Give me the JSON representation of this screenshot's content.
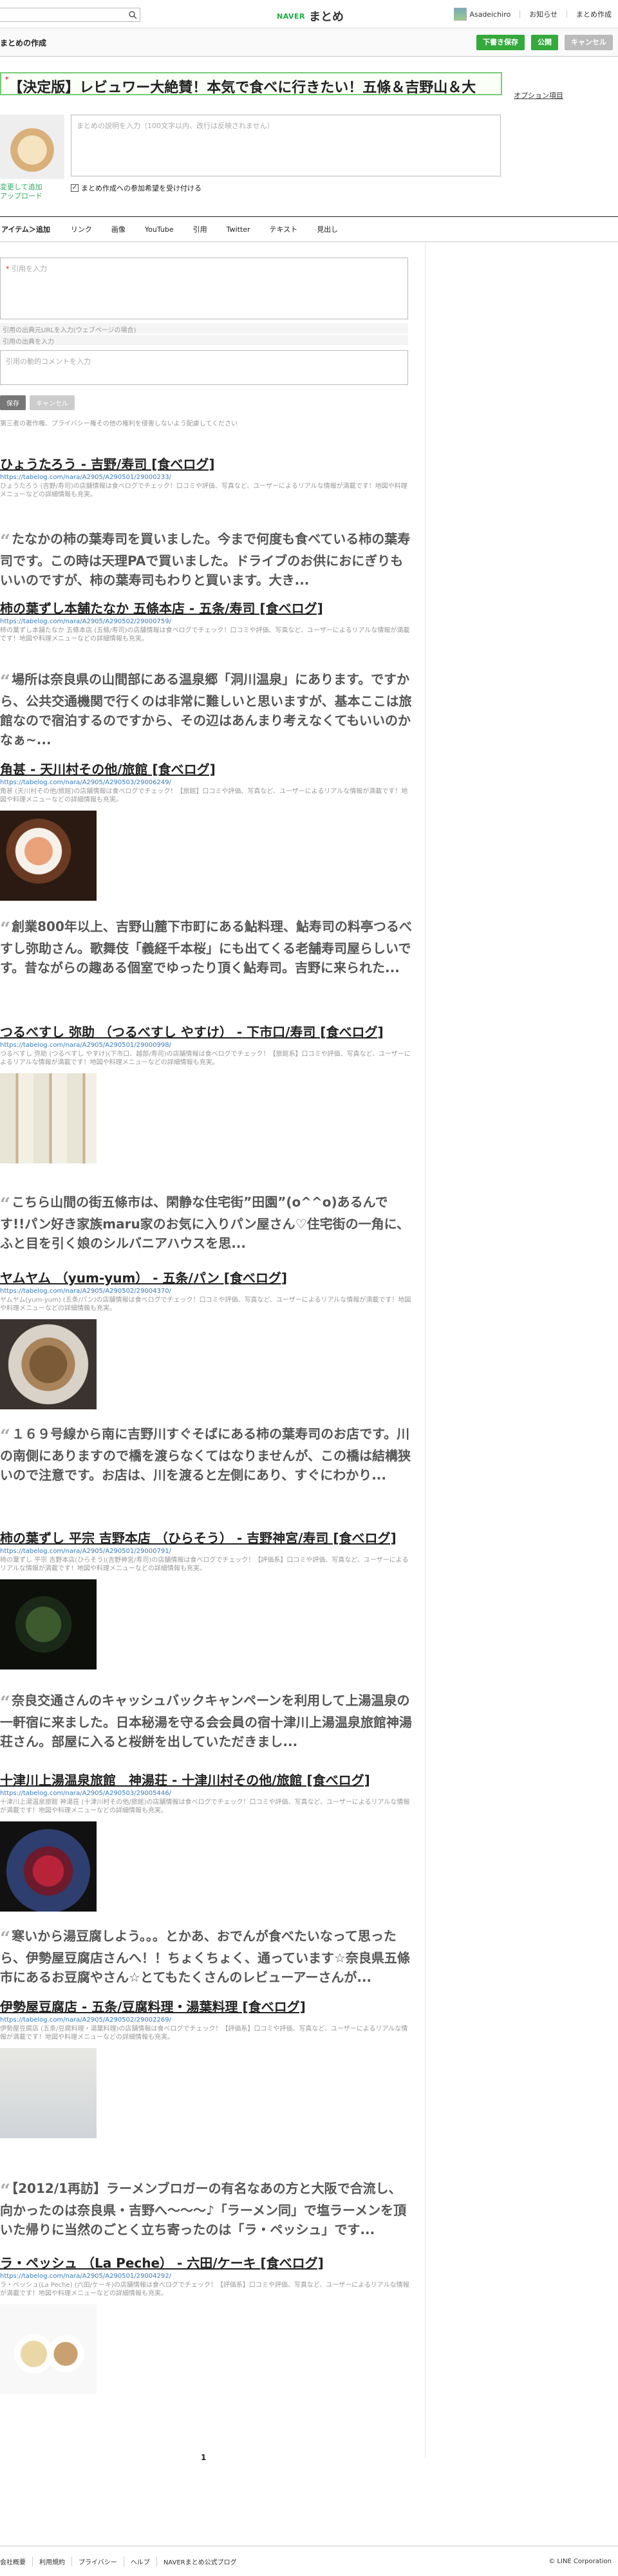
{
  "header": {
    "brand_naver": "NAVER",
    "brand_matome": "まとめ",
    "user_name": "Asadeichiro",
    "nav": [
      "お知らせ",
      "まとめ作成"
    ]
  },
  "subheader": {
    "title": "まとめの作成",
    "buttons": {
      "draft": "下書き保存",
      "publish": "公開",
      "cancel": "キャンセル"
    }
  },
  "editor": {
    "title_value": "【決定版】レビュワー大絶賛！本気で食べに行きたい！五條＆吉野山＆大",
    "options_link": "オプション項目",
    "thumb_change": "変更して追加",
    "thumb_upload": "アップロード",
    "description_placeholder": "まとめの説明を入力（100文字以内、改行は反映されません）",
    "participation_label": "まとめ作成への参加希望を受け付ける"
  },
  "tabs": {
    "lead": "アイテム＞追加",
    "items": [
      "リンク",
      "画像",
      "YouTube",
      "引用",
      "Twitter",
      "テキスト",
      "見出し"
    ]
  },
  "quote_form": {
    "text_placeholder": "引用を入力",
    "url_placeholder": "引用の出典元URLを入力(ウェブページの場合)",
    "source_placeholder": "引用の出典を入力",
    "comment_placeholder": "引用の動的コメントを入力",
    "save": "保存",
    "cancel": "キャンセル",
    "note": "第三者の著作権、プライバシー権その他の権利を侵害しないよう配慮してください"
  },
  "items": [
    {
      "kind": "link",
      "title": "ひょうたろう - 吉野/寿司 [食べログ]",
      "url": "https://tabelog.com/nara/A2905/A290501/29000233/",
      "snippet": "ひょうたろう (吉野/寿司)の店舗情報は食べログでチェック！口コミや評価、写真など、ユーザーによるリアルな情報が満載です！地図や料理メニューなどの詳細情報も充実。"
    },
    {
      "kind": "quote",
      "text": "たなかの柿の葉寿司を買いました。今まで何度も食べている柿の葉寿司です。この時は天理PAで買いました。ドライブのお供におにぎりもいいのですが、柿の葉寿司もわりと買います。大き..."
    },
    {
      "kind": "link",
      "title": "柿の葉ずし本舗たなか 五條本店 - 五条/寿司 [食べログ]",
      "url": "https://tabelog.com/nara/A2905/A290502/29000759/",
      "snippet": "柿の葉ずし本舗たなか 五條本店 (五條/寿司)の店舗情報は食べログでチェック！口コミや評価、写真など、ユーザーによるリアルな情報が満載です！地図や料理メニューなどの詳細情報も充実。"
    },
    {
      "kind": "quote",
      "text": "場所は奈良県の山間部にある温泉郷「洞川温泉」にあります。ですから、公共交通機関で行くのは非常に難しいと思いますが、基本ここは旅館なので宿泊するのですから、その辺はあんまり考えなくてもいいのかなぁ~..."
    },
    {
      "kind": "link",
      "title": "角甚 - 天川村その他/旅館 [食べログ]",
      "url": "https://tabelog.com/nara/A2905/A290503/29006249/",
      "snippet": "角甚 (天川村その他/旅館)の店舗情報は食べログでチェック！【旅館】口コミや評価、写真など、ユーザーによるリアルな情報が満載です！地図や料理メニューなどの詳細情報も充実。",
      "image": "sashimi"
    },
    {
      "kind": "quote",
      "text": "創業800年以上、吉野山麓下市町にある鮎料理、鮎寿司の料亭つるべすし弥助さん。歌舞伎「義経千本桜」にも出てくる老舗寿司屋らしいです。昔ながらの趣ある個室でゆったり頂く鮎寿司。吉野に来られた..."
    },
    {
      "kind": "link",
      "title": "つるべすし 弥助 （つるべすし やすけ） - 下市口/寿司 [食べログ]",
      "url": "https://tabelog.com/nara/A2905/A290501/29000998/",
      "snippet": "つるべすし 弥助 (つるべすし やすけ)(下市口、越部/寿司)の店舗情報は食べログでチェック！【旅館系】口コミや評価、写真など、ユーザーによるリアルな情報が満載です！地図や料理メニューなどの詳細情報も充実。",
      "image": "sushi"
    },
    {
      "kind": "quote",
      "text": "こちら山間の街五條市は、閑静な住宅街”田園”(o^^o)あるんです!!パン好き家族maru家のお気に入りパン屋さん♡住宅街の一角に、ふと目を引く娘のシルバニアハウスを思..."
    },
    {
      "kind": "link",
      "title": "ヤムヤム （yum-yum） - 五条/パン [食べログ]",
      "url": "https://tabelog.com/nara/A2905/A290502/29004370/",
      "snippet": "ヤムヤム(yum-yum) (五条/パン)の店舗情報は食べログでチェック！口コミや評価、写真など、ユーザーによるリアルな情報が満載です！地図や料理メニューなどの詳細情報も充実。",
      "image": "bread"
    },
    {
      "kind": "quote",
      "text": "１６９号線から南に吉野川すぐそばにある柿の葉寿司のお店です。川の南側にありますので橋を渡らなくてはなりませんが、この橋は結構狭いので注意です。お店は、川を渡ると左側にあり、すぐにわかり..."
    },
    {
      "kind": "link",
      "title": "柿の葉ずし 平宗 吉野本店 （ひらそう） - 吉野神宮/寿司 [食べログ]",
      "url": "https://tabelog.com/nara/A2905/A290501/29000791/",
      "snippet": "柿の葉ずし 平宗 吉野本店(ひらそう)(吉野神宮/寿司)の店舗情報は食べログでチェック！【評価系】口コミや評価、写真など、ユーザーによるリアルな情報が満載です！地図や料理メニューなどの詳細情報も充実。",
      "image": "kaki"
    },
    {
      "kind": "quote",
      "text": "奈良交通さんのキャッシュバックキャンペーンを利用して上湯温泉の一軒宿に来ました。日本秘湯を守る会会員の宿十津川上湯温泉旅館神湯荘さん。部屋に入ると桜餅を出していただきまし..."
    },
    {
      "kind": "link",
      "title": "十津川上湯温泉旅館　神湯荘 - 十津川村その他/旅館 [食べログ]",
      "url": "https://tabelog.com/nara/A2905/A290503/29005446/",
      "snippet": "十津川上湯温泉旅館 神湯荘 (十津川村その他/旅館)の店舗情報は食べログでチェック！口コミや評価、写真など、ユーザーによるリアルな情報が満載です！地図や料理メニューなどの詳細情報も充実。",
      "image": "tuna"
    },
    {
      "kind": "quote",
      "text": "寒いから湯豆腐しよう。。。とかあ、おでんが食べたいなって思ったら、伊勢屋豆腐店さんへ！！ちょくちょく、通っています☆奈良県五條市にあるお豆腐やさん☆とてもたくさんのレビューアーさんが..."
    },
    {
      "kind": "link",
      "title": "伊勢屋豆腐店 - 五条/豆腐料理・湯葉料理 [食べログ]",
      "url": "https://tabelog.com/nara/A2905/A290502/29002269/",
      "snippet": "伊勢屋豆腐店 (五条/豆腐料理・湯葉料理)の店舗情報は食べログでチェック！【評価系】口コミや評価、写真など、ユーザーによるリアルな情報が満載です！地図や料理メニューなどの詳細情報も充実。",
      "image": "tofu"
    },
    {
      "kind": "quote",
      "text": "【2012/1再訪】ラーメンブロガーの有名なあの方と大阪で合流し、向かったのは奈良県・吉野へ〜〜〜♪「ラーメン同」で塩ラーメンを頂いた帰りに当然のごとく立ち寄ったのは「ラ・ペッシュ」です..."
    },
    {
      "kind": "link",
      "title": "ラ・ペッシュ （La Peche） - 六田/ケーキ [食べログ]",
      "url": "https://tabelog.com/nara/A2905/A290501/29004292/",
      "snippet": "ラ・ペッシュ(La Peche) (六田/ケーキ)の店舗情報は食べログでチェック！【評価系】口コミや評価、写真など、ユーザーによるリアルな情報が満載です！地図や料理メニューなどの詳細情報も充実。",
      "image": "cake"
    }
  ],
  "pager": {
    "current": "1"
  },
  "footer": {
    "links": [
      "会社概要",
      "利用規約",
      "プライバシー",
      "ヘルプ",
      "NAVERまとめ公式ブログ"
    ],
    "copyright": "© LINE Corporation"
  }
}
